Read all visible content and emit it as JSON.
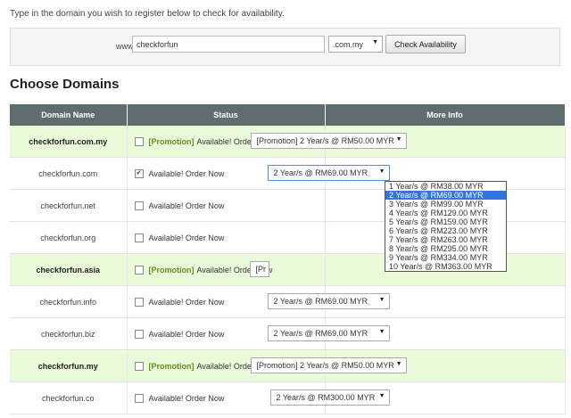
{
  "intro_text": "Type in the domain you wish to register below to check for availability.",
  "search": {
    "www_label": "www.",
    "domain_value": "checkforfun",
    "tld_value": ".com.my",
    "check_button": "Check Availability"
  },
  "section_title": "Choose Domains",
  "table": {
    "headers": [
      "Domain Name",
      "Status",
      "More Info"
    ],
    "rows": [
      {
        "domain": "checkforfun.com.my",
        "promo": true,
        "checked": false,
        "promo_label": "[Promotion]",
        "status": "Available! Order Now",
        "option": "[Promotion] 2 Year/s @ RM50.00 MYR"
      },
      {
        "domain": "checkforfun.com",
        "promo": false,
        "checked": true,
        "promo_label": "",
        "status": "Available! Order Now",
        "option": "2 Year/s @ RM69.00 MYR"
      },
      {
        "domain": "checkforfun.net",
        "promo": false,
        "checked": false,
        "promo_label": "",
        "status": "Available! Order Now",
        "option": ""
      },
      {
        "domain": "checkforfun.org",
        "promo": false,
        "checked": false,
        "promo_label": "",
        "status": "Available! Order Now",
        "option": ""
      },
      {
        "domain": "checkforfun.asia",
        "promo": true,
        "checked": false,
        "promo_label": "[Promotion]",
        "status": "Available! Order Now",
        "option": "[Pr"
      },
      {
        "domain": "checkforfun.info",
        "promo": false,
        "checked": false,
        "promo_label": "",
        "status": "Available! Order Now",
        "option": "2 Year/s @ RM69.00 MYR"
      },
      {
        "domain": "checkforfun.biz",
        "promo": false,
        "checked": false,
        "promo_label": "",
        "status": "Available! Order Now",
        "option": "2 Year/s @ RM69.00 MYR"
      },
      {
        "domain": "checkforfun.my",
        "promo": true,
        "checked": false,
        "promo_label": "[Promotion]",
        "status": "Available! Order Now",
        "option": "[Promotion] 2 Year/s @ RM50.00 MYR"
      },
      {
        "domain": "checkforfun.co",
        "promo": false,
        "checked": false,
        "promo_label": "",
        "status": "Available! Order Now",
        "option": "2 Year/s @ RM300.00 MYR"
      }
    ]
  },
  "dropdown": {
    "options": [
      "1 Year/s @ RM38.00 MYR",
      "2 Year/s @ RM69.00 MYR",
      "3 Year/s @ RM99.00 MYR",
      "4 Year/s @ RM129.00 MYR",
      "5 Year/s @ RM159.00 MYR",
      "6 Year/s @ RM223.00 MYR",
      "7 Year/s @ RM263.00 MYR",
      "8 Year/s @ RM295.00 MYR",
      "9 Year/s @ RM334.00 MYR",
      "10 Year/s @ RM363.00 MYR"
    ],
    "selected_index": 1
  },
  "colors": {
    "header_bg": "#5e6e6e",
    "promo_row_bg": "#e9fbd9",
    "promo_text": "#5e8f1e",
    "selected_option": "#3176e0"
  }
}
